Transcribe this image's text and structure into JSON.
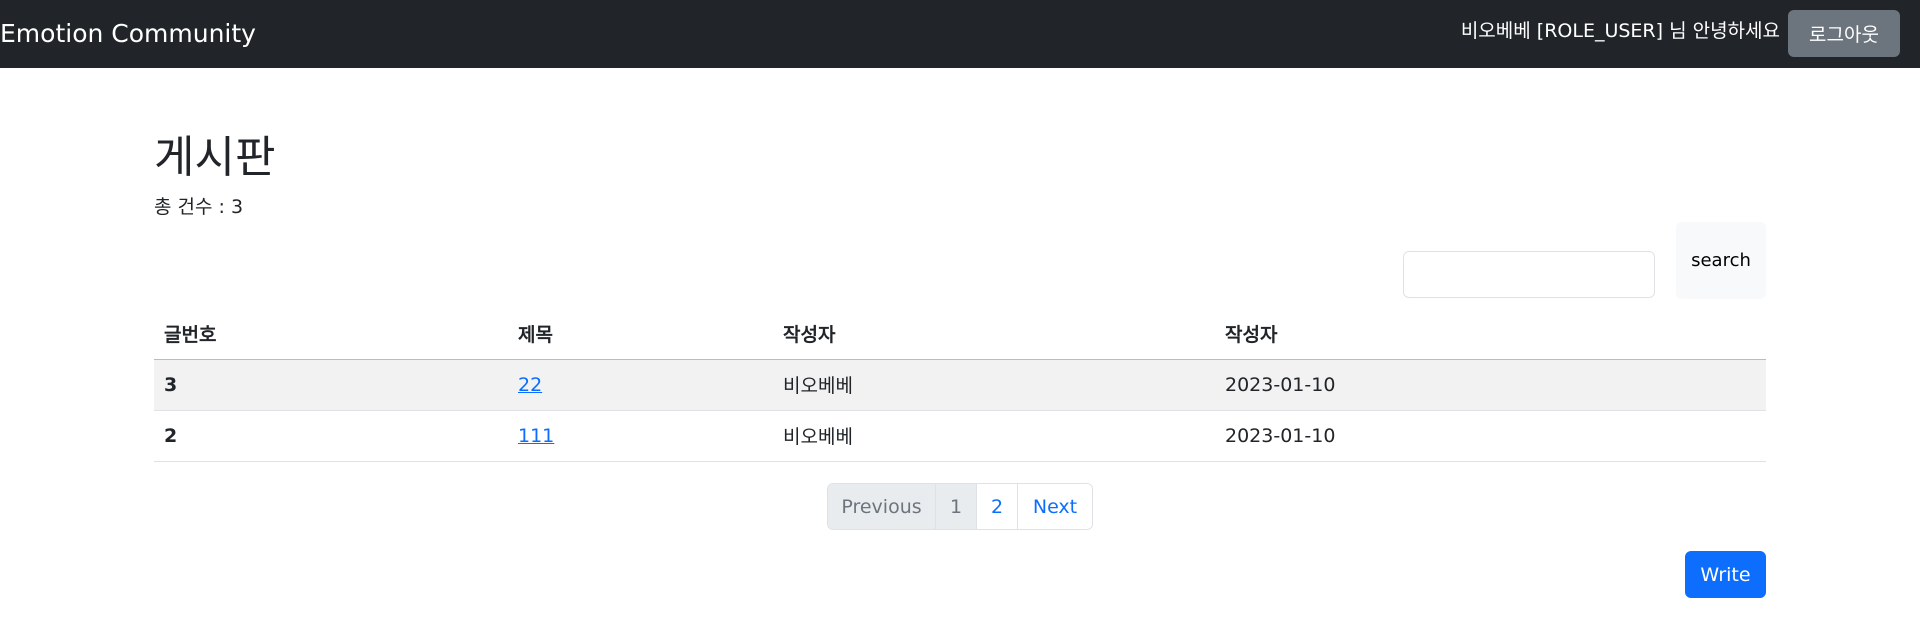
{
  "navbar": {
    "brand": "Emotion Community",
    "greeting": "비오베베 [ROLE_USER] 님 안녕하세요",
    "logout_label": "로그아웃"
  },
  "main": {
    "title": "게시판",
    "total_count": "총 건수 : 3"
  },
  "search": {
    "value": "",
    "placeholder": "",
    "button_label": "search"
  },
  "table": {
    "headers": [
      "글번호",
      "제목",
      "작성자",
      "작성자"
    ],
    "rows": [
      {
        "no": "3",
        "title": "22",
        "author": "비오베베",
        "date": "2023-01-10"
      },
      {
        "no": "2",
        "title": "111",
        "author": "비오베베",
        "date": "2023-01-10"
      }
    ]
  },
  "pagination": {
    "previous": "Previous",
    "pages": [
      "1",
      "2"
    ],
    "next": "Next",
    "current_page": "1"
  },
  "write_label": "Write",
  "colors": {
    "navbar_bg": "#212529",
    "primary": "#0d6efd",
    "secondary": "#6c757d"
  }
}
